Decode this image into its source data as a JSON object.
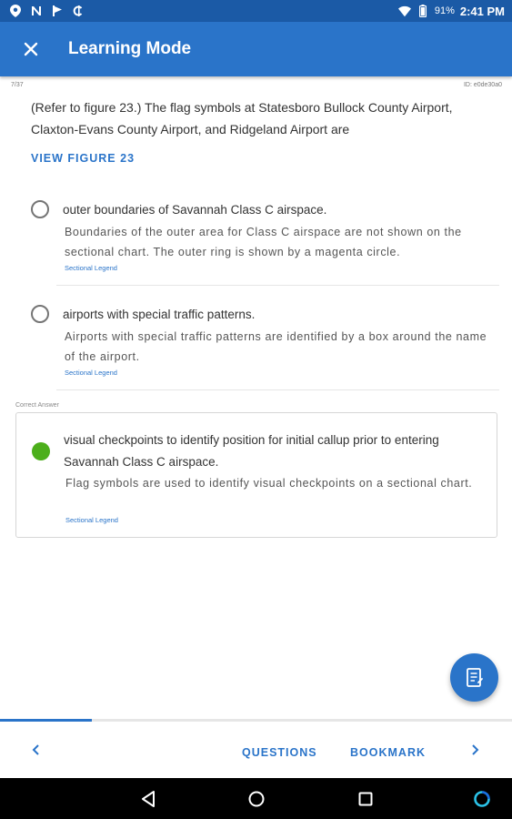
{
  "status_bar": {
    "time": "2:41 PM",
    "battery_percent": "91%",
    "left_icons": [
      "location-icon",
      "n-app-icon",
      "flag-app-icon",
      "currency-app-icon"
    ],
    "right_icons": [
      "wifi-icon",
      "battery-icon"
    ]
  },
  "app_bar": {
    "title": "Learning Mode",
    "close_icon": "close-icon",
    "color": "#2a74c9"
  },
  "meta": {
    "counter": "7/37",
    "question_id": "ID: e0de30a0"
  },
  "question": {
    "text": "(Refer to figure 23.) The flag symbols at Statesboro Bullock County Airport, Claxton-Evans County Airport, and Ridgeland Airport are",
    "view_figure_label": "VIEW FIGURE 23"
  },
  "options": [
    {
      "label": "outer boundaries of Savannah Class C airspace.",
      "explanation": "Boundaries of the outer area for Class C airspace are not shown on the sectional chart.  The outer ring is shown by a magenta circle.",
      "reference": "Sectional Legend",
      "selected": false
    },
    {
      "label": "airports with special traffic patterns.",
      "explanation": "Airports with special traffic patterns are identified by a box around the name of the airport.",
      "reference": "Sectional Legend",
      "selected": false
    }
  ],
  "correct": {
    "heading": "Correct Answer",
    "label": "visual checkpoints to identify position for initial callup prior to entering Savannah Class C airspace.",
    "explanation": "Flag symbols are used to identify visual checkpoints on a sectional chart.",
    "reference": "Sectional Legend",
    "color": "#4caf1b"
  },
  "progress": {
    "fraction": 0.18
  },
  "bottom_bar": {
    "prev_icon": "chevron-left-icon",
    "questions_label": "QUESTIONS",
    "bookmark_label": "BOOKMARK",
    "next_icon": "chevron-right-icon"
  },
  "fab": {
    "icon": "notes-icon"
  },
  "nav_bar": {
    "icons": [
      "back-triangle-icon",
      "home-circle-icon",
      "recents-square-icon",
      "assistant-ring-icon"
    ]
  }
}
